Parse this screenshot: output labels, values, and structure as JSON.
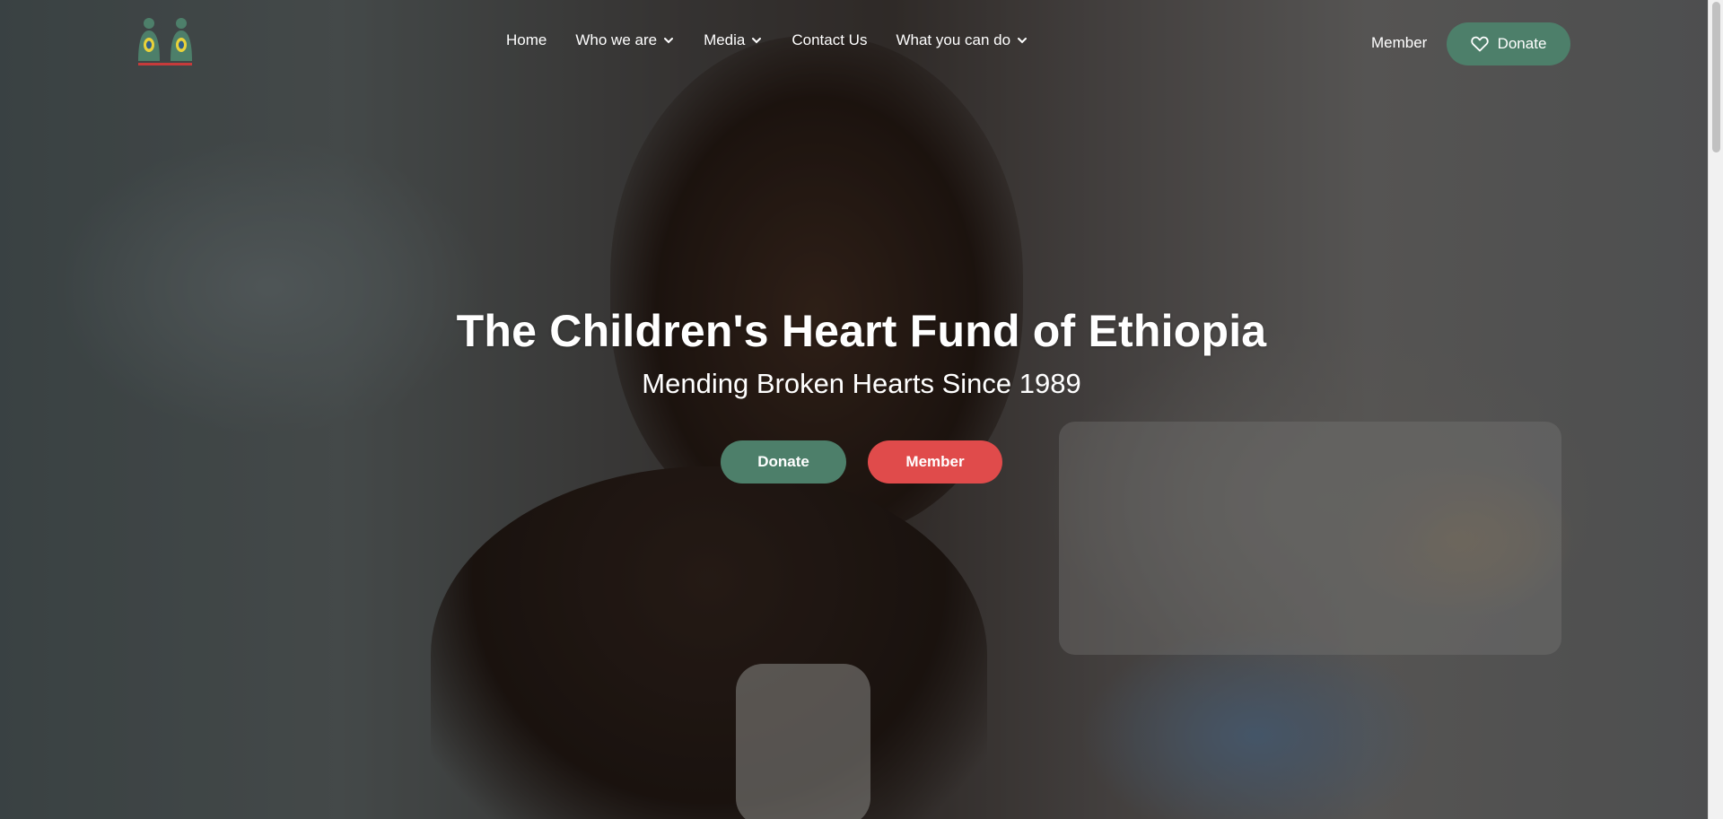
{
  "colors": {
    "brand_green": "#4d7f6a",
    "accent_red": "#e04b4b",
    "text": "#ffffff"
  },
  "header": {
    "logo_icon": "organization-logo-icon",
    "nav": [
      {
        "label": "Home",
        "has_dropdown": false
      },
      {
        "label": "Who we are",
        "has_dropdown": true
      },
      {
        "label": "Media",
        "has_dropdown": true
      },
      {
        "label": "Contact Us",
        "has_dropdown": false
      },
      {
        "label": "What you can do",
        "has_dropdown": true
      }
    ],
    "member_label": "Member",
    "donate_label": "Donate",
    "donate_icon": "heart-icon"
  },
  "hero": {
    "title": "The Children's Heart Fund of Ethiopia",
    "subtitle": "Mending Broken Hearts Since 1989",
    "donate_button": "Donate",
    "member_button": "Member"
  }
}
